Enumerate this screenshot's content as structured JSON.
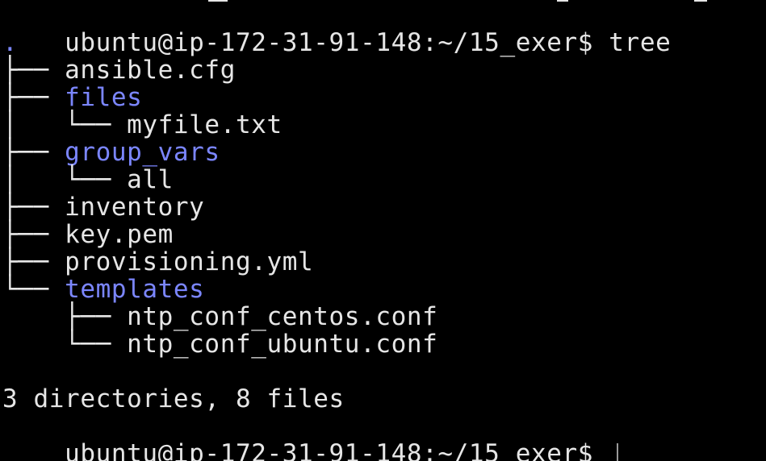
{
  "terminal": {
    "prompt1": "ubuntu@ip-172-31-91-148:~/15_exer$ ",
    "command": "tree",
    "root": ".",
    "entries": [
      {
        "connector": "├── ",
        "name": "ansible.cfg",
        "type": "file"
      },
      {
        "connector": "├── ",
        "name": "files",
        "type": "dir"
      },
      {
        "connector": "│   └── ",
        "name": "myfile.txt",
        "type": "file"
      },
      {
        "connector": "├── ",
        "name": "group_vars",
        "type": "dir"
      },
      {
        "connector": "│   └── ",
        "name": "all",
        "type": "file"
      },
      {
        "connector": "├── ",
        "name": "inventory",
        "type": "file"
      },
      {
        "connector": "├── ",
        "name": "key.pem",
        "type": "file"
      },
      {
        "connector": "├── ",
        "name": "provisioning.yml",
        "type": "file"
      },
      {
        "connector": "└── ",
        "name": "templates",
        "type": "dir"
      },
      {
        "connector": "    ├── ",
        "name": "ntp_conf_centos.conf",
        "type": "file"
      },
      {
        "connector": "    └── ",
        "name": "ntp_conf_ubuntu.conf",
        "type": "file"
      }
    ],
    "summary": "3 directories, 8 files",
    "prompt2": "ubuntu@ip-172-31-91-148:~/15_exer$ ",
    "colors": {
      "background": "#000000",
      "text": "#e6e6e6",
      "directory": "#7b86ff"
    }
  }
}
